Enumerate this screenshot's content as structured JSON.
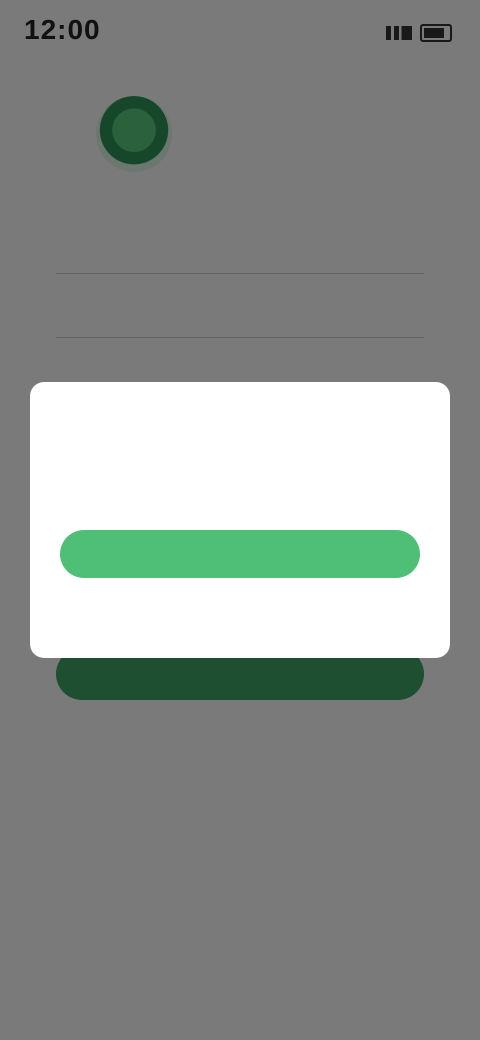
{
  "status_bar": {
    "time": "12:00"
  },
  "brand": {
    "name": "",
    "subtitle": ""
  },
  "form": {
    "field1_placeholder": "",
    "field2_placeholder": "",
    "login_button": "",
    "link_text": ""
  },
  "dialog": {
    "message": "",
    "confirm_label": "",
    "cancel_label": ""
  },
  "colors": {
    "accent": "#4fbf77",
    "accent_dark": "#3d9f60",
    "overlay": "rgba(0,0,0,0.5)"
  },
  "icons": [
    "signal-icon",
    "battery-icon",
    "app-logo-icon"
  ]
}
